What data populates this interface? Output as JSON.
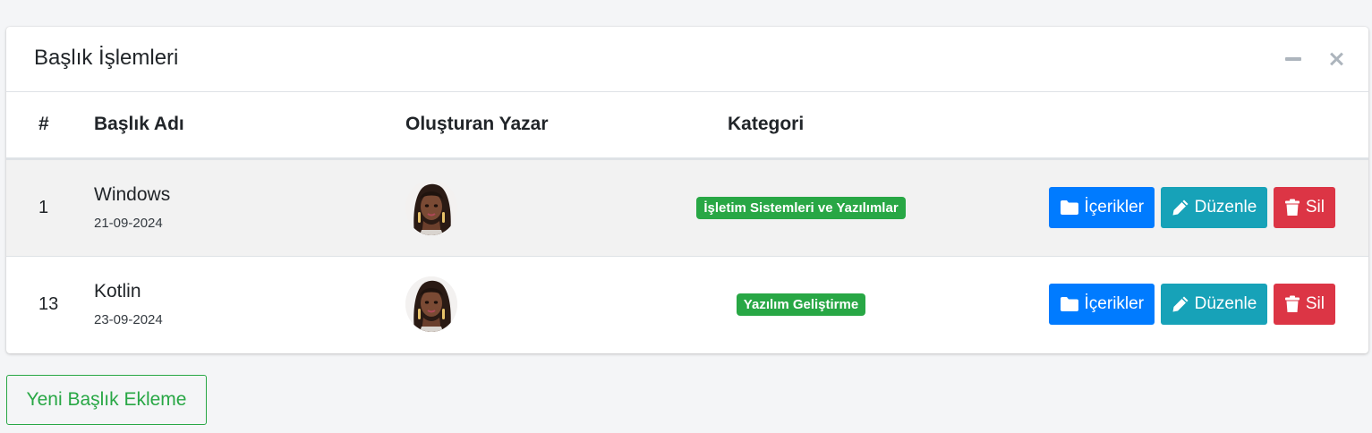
{
  "card": {
    "title": "Başlık İşlemleri"
  },
  "table": {
    "headers": {
      "num": "#",
      "title": "Başlık Adı",
      "author": "Oluşturan Yazar",
      "category": "Kategori"
    },
    "rows": [
      {
        "num": "1",
        "title": "Windows",
        "date": "21-09-2024",
        "category": "İşletim Sistemleri ve Yazılımlar"
      },
      {
        "num": "13",
        "title": "Kotlin",
        "date": "23-09-2024",
        "category": "Yazılım Geliştirme"
      }
    ],
    "actions": {
      "contents_label": "İçerikler",
      "edit_label": "Düzenle",
      "delete_label": "Sil"
    }
  },
  "footer": {
    "new_button_label": "Yeni Başlık Ekleme"
  },
  "colors": {
    "primary": "#007bff",
    "info": "#17a2b8",
    "danger": "#dc3545",
    "success": "#28a745"
  },
  "icons": {
    "card_minimize": "minus-icon",
    "card_close": "close-icon",
    "contents": "folder-icon",
    "edit": "pencil-icon",
    "delete": "trash-icon"
  }
}
